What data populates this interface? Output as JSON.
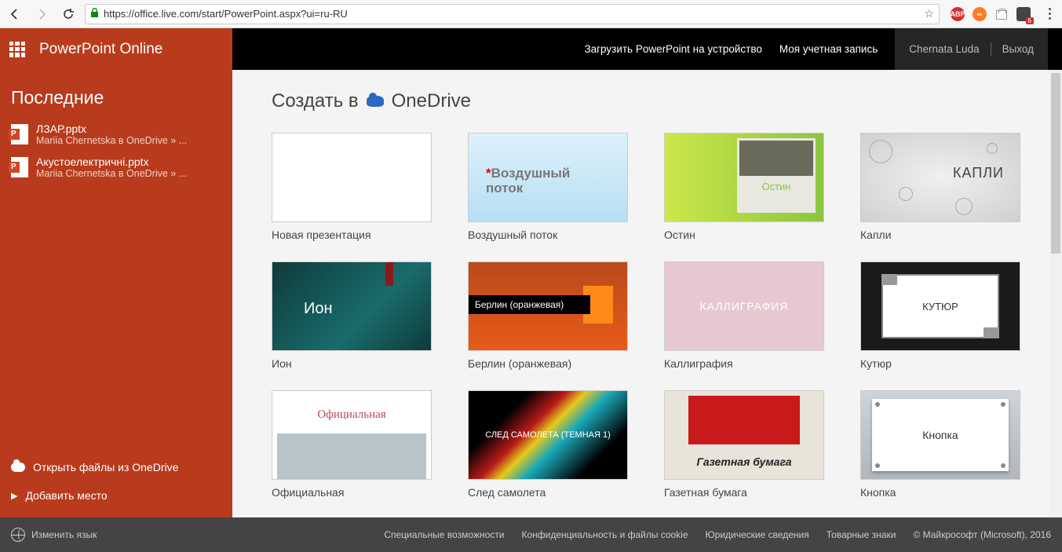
{
  "browser": {
    "url": "https://office.live.com/start/PowerPoint.aspx?ui=ru-RU",
    "ext_abp": "ABP",
    "badge": "6"
  },
  "header": {
    "app_title": "PowerPoint Online",
    "download": "Загрузить PowerPoint на устройство",
    "my_account": "Моя учетная запись",
    "user": "Chernata Luda",
    "exit": "Выход"
  },
  "sidebar": {
    "recent_title": "Последние",
    "items": [
      {
        "name": "ЛЗАР.pptx",
        "loc": "Mariia Chernetska в OneDrive » ..."
      },
      {
        "name": "Акустоелектричні.pptx",
        "loc": "Mariia Chernetska в OneDrive » ..."
      }
    ],
    "open_onedrive": "Открыть файлы из OneDrive",
    "add_place": "Добавить место"
  },
  "content": {
    "create_in": "Создать в",
    "onedrive": "OneDrive",
    "templates": [
      {
        "label": "Новая презентация",
        "thumb_text": ""
      },
      {
        "label": "Воздушный поток",
        "thumb_text": "Воздушный поток"
      },
      {
        "label": "Остин",
        "thumb_text": "Остин"
      },
      {
        "label": "Капли",
        "thumb_text": "КАПЛИ"
      },
      {
        "label": "Ион",
        "thumb_text": "Ион"
      },
      {
        "label": "Берлин (оранжевая)",
        "thumb_text": "Берлин (оранжевая)"
      },
      {
        "label": "Каллиграфия",
        "thumb_text": "КАЛЛИГРАФИЯ"
      },
      {
        "label": "Кутюр",
        "thumb_text": "КУТЮР"
      },
      {
        "label": "Официальная",
        "thumb_text": "Официальная"
      },
      {
        "label": "След самолета",
        "thumb_text": "СЛЕД САМОЛЕТА (ТЕМНАЯ 1)"
      },
      {
        "label": "Газетная бумага",
        "thumb_text": "Газетная бумага"
      },
      {
        "label": "Кнопка",
        "thumb_text": "Кнопка"
      }
    ]
  },
  "footer": {
    "change_lang": "Изменить язык",
    "links": [
      "Специальные возможности",
      "Конфиденциальность и файлы cookie",
      "Юридические сведения",
      "Товарные знаки",
      "© Майкрософт (Microsoft), 2016"
    ]
  }
}
